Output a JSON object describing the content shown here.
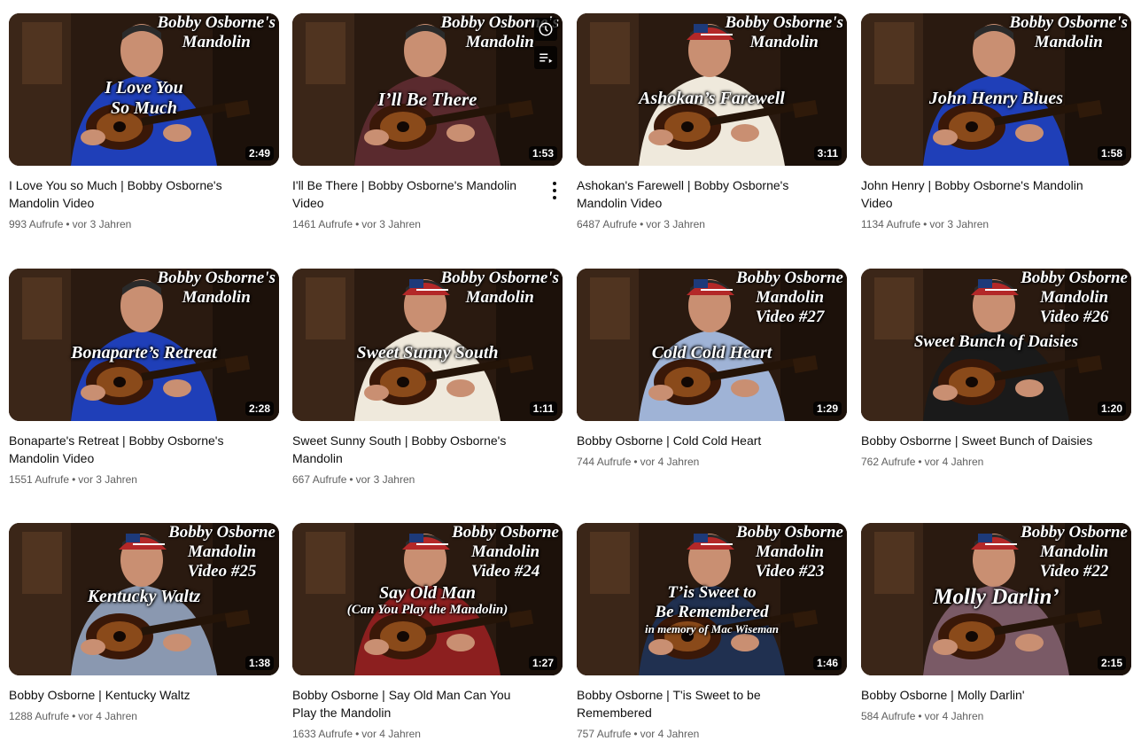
{
  "brand": {
    "line1": "Bobby Osborne's",
    "line2": "Mandolin",
    "line1_alt": "Bobby Osborne"
  },
  "videos": [
    {
      "title": "I Love You so Much | Bobby Osborne's Mandolin Video",
      "views": "993 Aufrufe",
      "age": "vor 3 Jahren",
      "duration": "2:49",
      "thumb_title_1": "I Love You",
      "thumb_title_2": "So Much",
      "shirt": "#1f3fb8"
    },
    {
      "title": "I'll Be There | Bobby Osborne's Mandolin Video",
      "views": "1461 Aufrufe",
      "age": "vor 3 Jahren",
      "duration": "1:53",
      "thumb_title_1": "I’ll Be There",
      "shirt": "#5a2a2e"
    },
    {
      "title": "Ashokan's Farewell | Bobby Osborne's Mandolin Video",
      "views": "6487 Aufrufe",
      "age": "vor 3 Jahren",
      "duration": "3:11",
      "thumb_title_1": "Ashokan’s Farewell",
      "shirt": "#efe9dc"
    },
    {
      "title": "John Henry | Bobby Osborne's Mandolin Video",
      "views": "1134 Aufrufe",
      "age": "vor 3 Jahren",
      "duration": "1:58",
      "thumb_title_1": "John Henry Blues",
      "shirt": "#1f3fb8"
    },
    {
      "title": "Bonaparte's Retreat | Bobby Osborne's Mandolin Video",
      "views": "1551 Aufrufe",
      "age": "vor 3 Jahren",
      "duration": "2:28",
      "thumb_title_1": "Bonaparte’s Retreat",
      "shirt": "#1f3fb8"
    },
    {
      "title": "Sweet Sunny South | Bobby Osborne's Mandolin",
      "views": "667 Aufrufe",
      "age": "vor 3 Jahren",
      "duration": "1:11",
      "thumb_title_1": "Sweet Sunny South",
      "shirt": "#efe9dc"
    },
    {
      "title": "Bobby Osborne | Cold Cold Heart",
      "views": "744 Aufrufe",
      "age": "vor 4 Jahren",
      "duration": "1:29",
      "thumb_title_1": "Cold Cold Heart",
      "video_no": "Video #27",
      "shirt": "#9fb3d6"
    },
    {
      "title": "Bobby Osborrne | Sweet Bunch of Daisies",
      "views": "762 Aufrufe",
      "age": "vor 4 Jahren",
      "duration": "1:20",
      "thumb_title_1": "Sweet Bunch of Daisies",
      "video_no": "Video #26",
      "shirt": "#1a1a1a"
    },
    {
      "title": "Bobby Osborne | Kentucky Waltz",
      "views": "1288 Aufrufe",
      "age": "vor 4 Jahren",
      "duration": "1:38",
      "thumb_title_1": "Kentucky Waltz",
      "video_no": "Video #25",
      "shirt": "#8a98b0"
    },
    {
      "title": "Bobby Osborne | Say Old Man Can You Play the Mandolin",
      "views": "1633 Aufrufe",
      "age": "vor 4 Jahren",
      "duration": "1:27",
      "thumb_title_1": "Say Old Man",
      "thumb_title_2": "(Can You Play the Mandolin)",
      "video_no": "Video #24",
      "shirt": "#8c1f1f"
    },
    {
      "title": "Bobby Osborne | T'is Sweet to be Remembered",
      "views": "757 Aufrufe",
      "age": "vor 4 Jahren",
      "duration": "1:46",
      "thumb_title_1": "T’is Sweet to",
      "thumb_title_2": "Be Remembered",
      "thumb_title_3": "in memory of Mac Wiseman",
      "video_no": "Video #23",
      "shirt": "#203050"
    },
    {
      "title": "Bobby Osborne | Molly Darlin'",
      "views": "584 Aufrufe",
      "age": "vor 4 Jahren",
      "duration": "2:15",
      "thumb_title_1": "Molly Darlin’",
      "video_no": "Video #22",
      "shirt": "#7a5a66"
    }
  ],
  "icons": {
    "watch_later": "clock-icon",
    "add_to_queue": "queue-icon",
    "more": "more-vert-icon"
  }
}
